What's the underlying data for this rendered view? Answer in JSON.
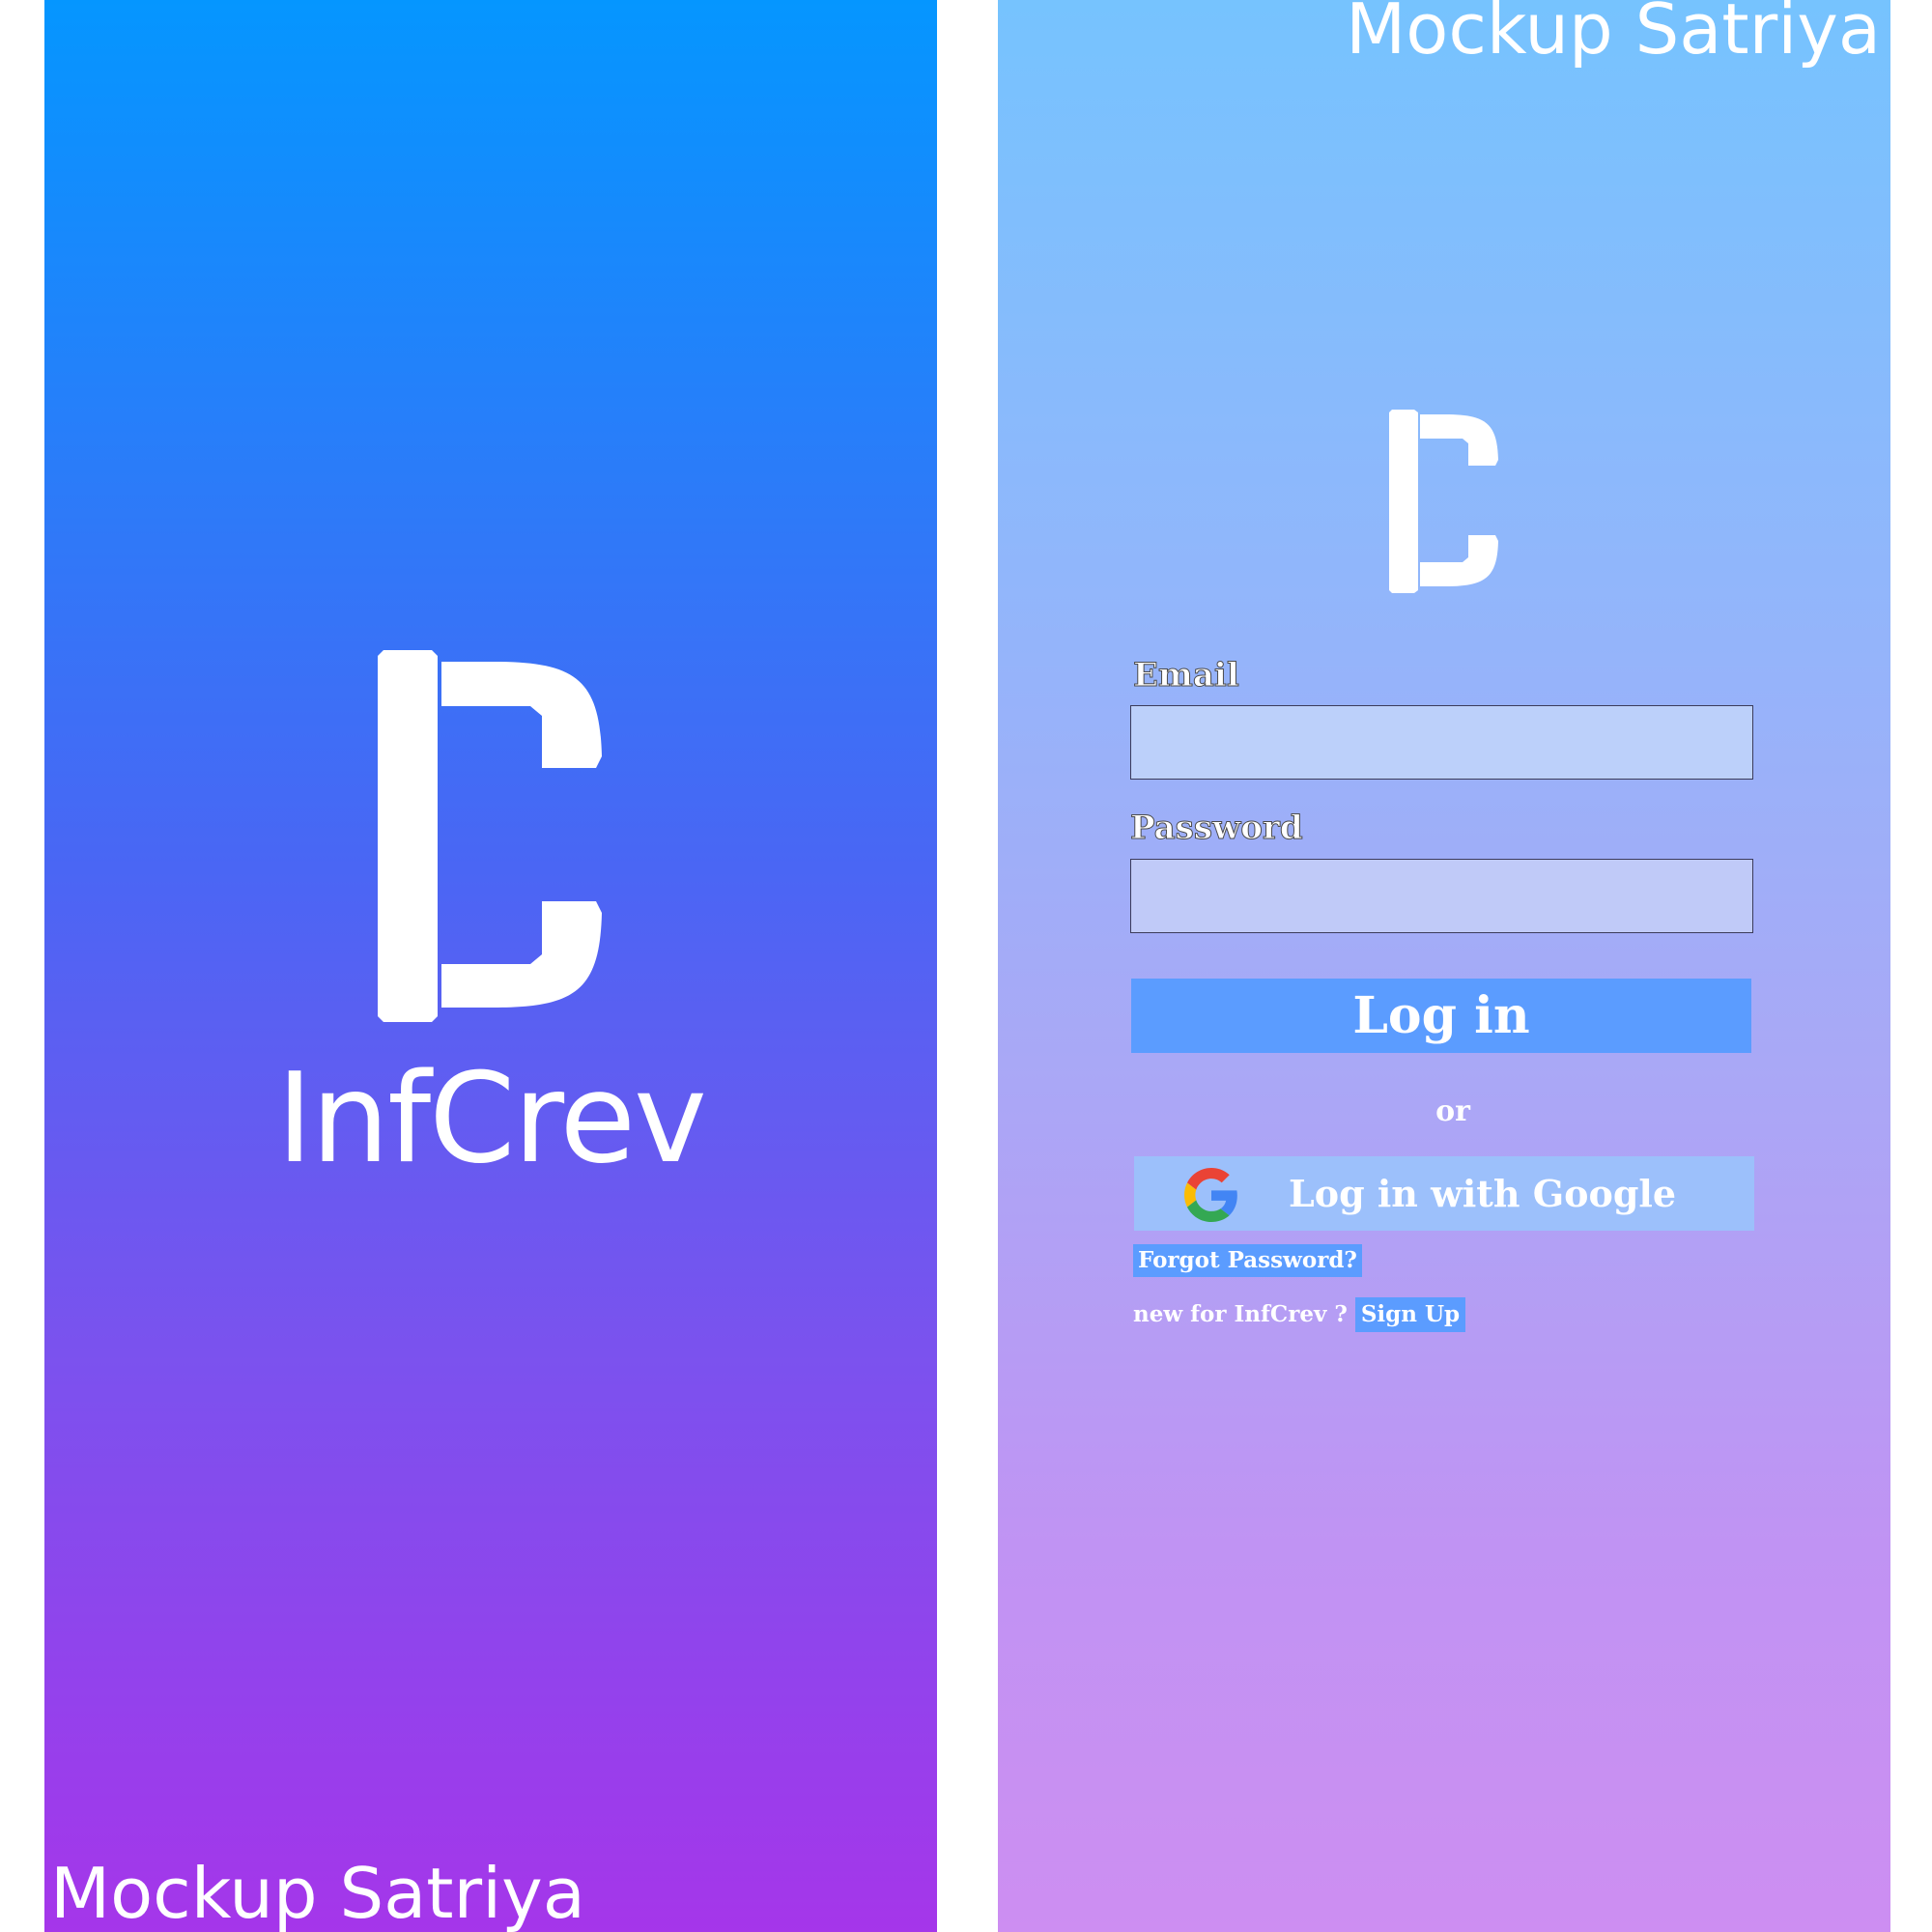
{
  "colors": {
    "white": "#ffffff",
    "splash_gradient_top": "#0596ff",
    "splash_gradient_bottom": "#a536ea",
    "login_gradient_top": "#76c3fe",
    "login_gradient_bottom": "#cd8ef2",
    "primary_button": "#5b9cff",
    "google_button": "#9cc0fb"
  },
  "splash": {
    "logo_icon": "infcrev-logo-icon",
    "app_name": "InfCrev",
    "watermark": "Mockup Satriya"
  },
  "login": {
    "watermark": "Mockup Satriya",
    "logo_icon": "infcrev-logo-icon",
    "email": {
      "label": "Email",
      "value": "",
      "placeholder": ""
    },
    "password": {
      "label": "Password",
      "value": "",
      "placeholder": ""
    },
    "login_button_label": "Log in",
    "divider_text": "or",
    "google_button": {
      "icon": "google-icon",
      "label": "Log in with Google"
    },
    "forgot_password_label": "Forgot Password?",
    "signup_prompt": "new for InfCrev ?",
    "signup_label": "Sign Up"
  }
}
